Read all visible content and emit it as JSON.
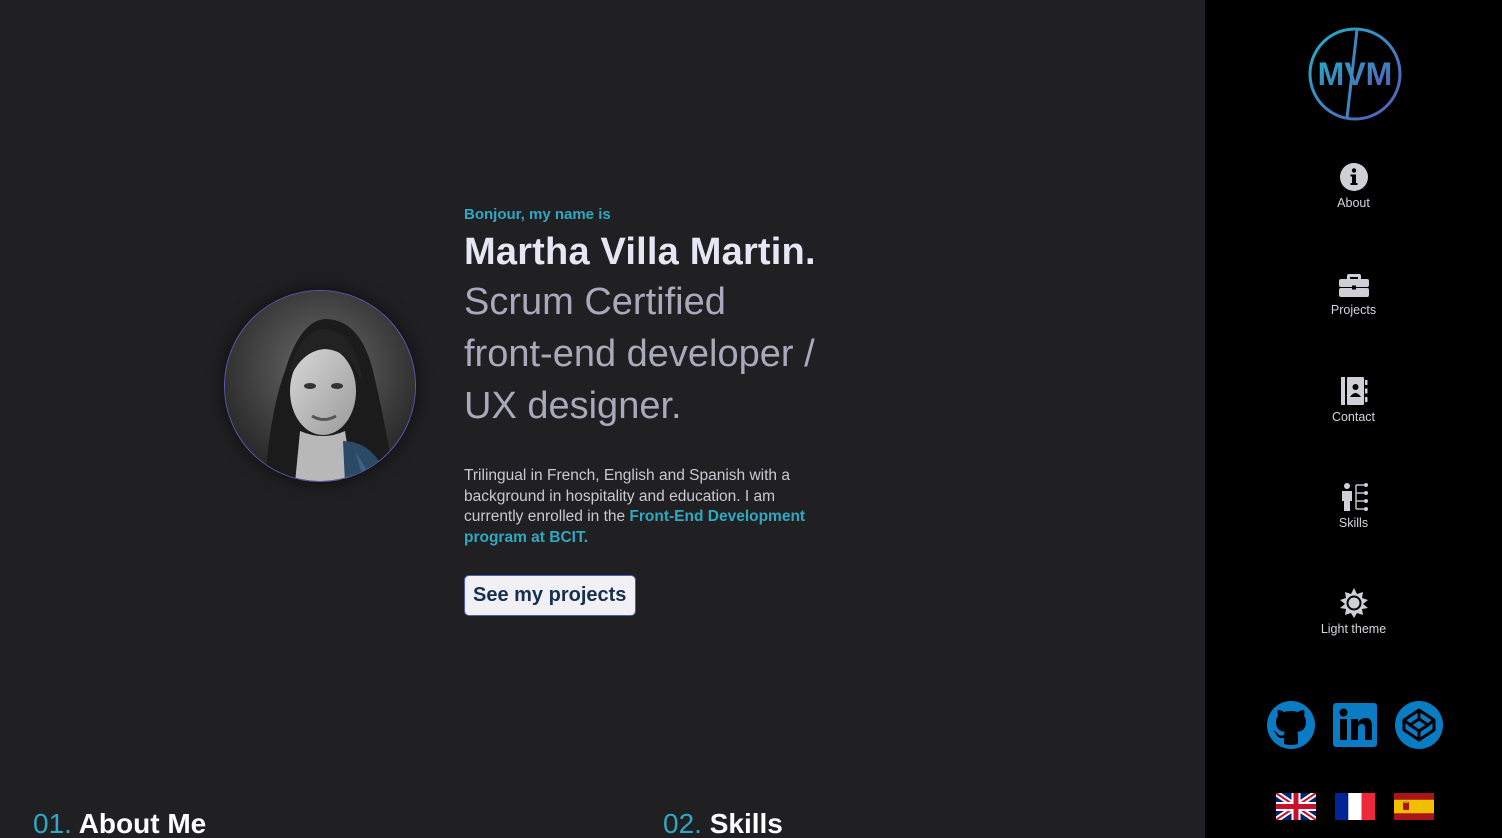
{
  "intro": {
    "greeting": "Bonjour, my name is",
    "name": "Martha Villa Martin.",
    "role_lines": [
      "Scrum Certified",
      "front-end developer /",
      "UX designer."
    ],
    "bio_text": "Trilingual in French, English and Spanish with a background in hospitality and education. I am currently enrolled in the ",
    "bio_link": "Front-End Development program at BCIT.",
    "cta_label": "See my projects"
  },
  "sections": [
    {
      "number": "01.",
      "title": "About Me"
    },
    {
      "number": "02.",
      "title": "Skills"
    }
  ],
  "sidebar": {
    "logo_text": "MVM",
    "nav": [
      {
        "label": "About",
        "icon": "info-icon"
      },
      {
        "label": "Projects",
        "icon": "briefcase-icon"
      },
      {
        "label": "Contact",
        "icon": "address-book-icon"
      },
      {
        "label": "Skills",
        "icon": "skills-tree-icon"
      },
      {
        "label": "Light theme",
        "icon": "sun-icon"
      }
    ],
    "social": [
      {
        "name": "GitHub",
        "icon": "github-icon"
      },
      {
        "name": "LinkedIn",
        "icon": "linkedin-icon"
      },
      {
        "name": "CodePen",
        "icon": "codepen-icon"
      }
    ],
    "languages": [
      {
        "lang": "English",
        "icon": "uk-flag-icon"
      },
      {
        "lang": "French",
        "icon": "france-flag-icon"
      },
      {
        "lang": "Spanish",
        "icon": "spain-flag-icon"
      }
    ]
  },
  "colors": {
    "accent": "#2fa8c0",
    "main_bg": "#201f22",
    "sidebar_bg": "#000000",
    "social_blue": "#0a7cc4"
  }
}
